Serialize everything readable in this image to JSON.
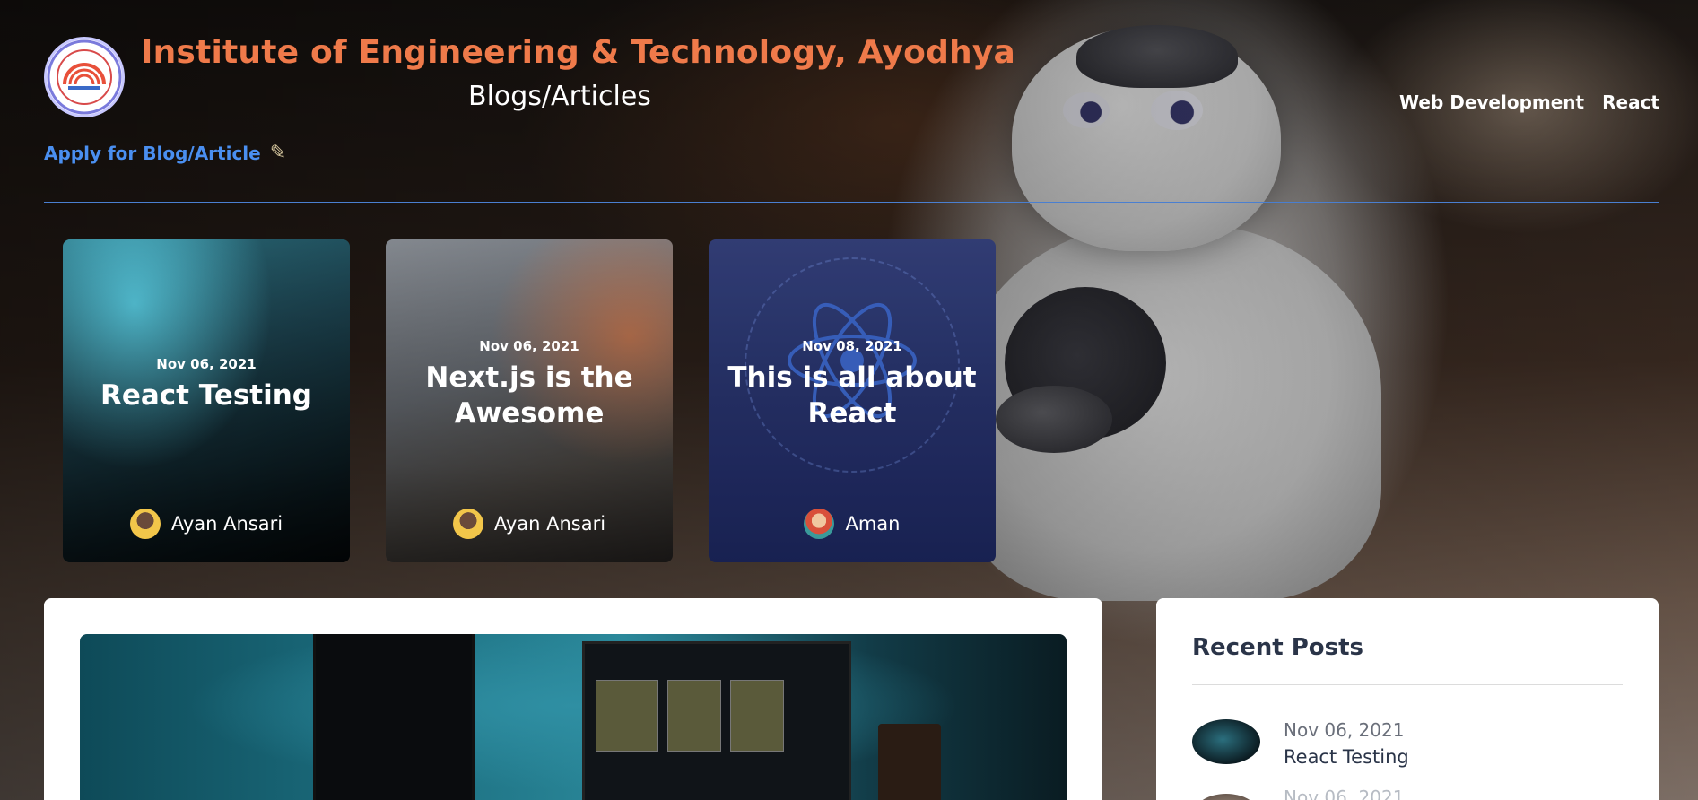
{
  "header": {
    "site_title": "Institute of Engineering & Technology, Ayodhya",
    "subtitle": "Blogs/Articles",
    "apply_label": "Apply for Blog/Article",
    "apply_icon": "pen-icon",
    "logo_icon": "institute-logo-icon"
  },
  "nav": {
    "items": [
      {
        "label": "Web Development"
      },
      {
        "label": "React"
      }
    ]
  },
  "featured": [
    {
      "date": "Nov 06, 2021",
      "title": "React Testing",
      "author": "Ayan Ansari"
    },
    {
      "date": "Nov 06, 2021",
      "title": "Next.js is the Awesome",
      "author": "Ayan Ansari"
    },
    {
      "date": "Nov 08, 2021",
      "title": "This is all about React",
      "author": "Aman"
    }
  ],
  "sidebar": {
    "title": "Recent Posts",
    "posts": [
      {
        "date": "Nov 06, 2021",
        "title": "React Testing"
      },
      {
        "date": "Nov 06, 2021",
        "title": ""
      }
    ]
  },
  "colors": {
    "title_orange": "#ef7a4a",
    "link_blue": "#4a8ff0",
    "divider_blue": "#4a7fd0",
    "card_blue": "#253066"
  }
}
